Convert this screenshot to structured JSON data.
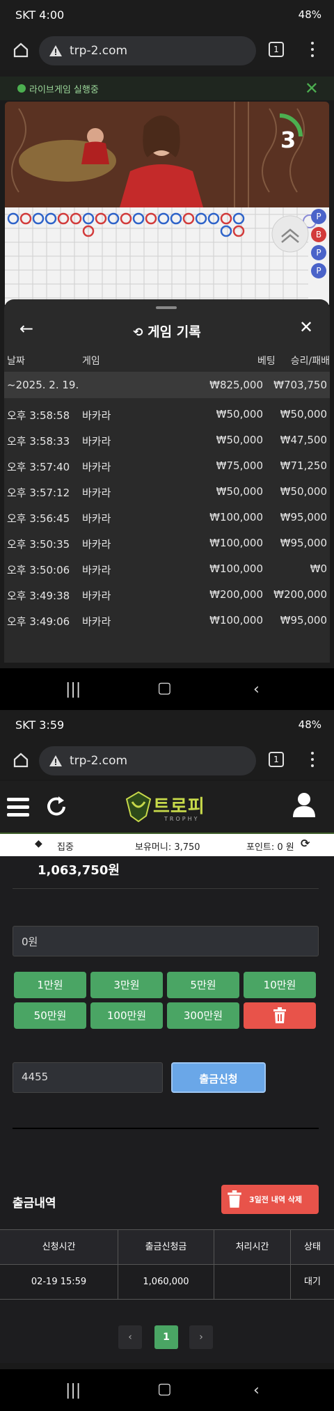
{
  "screen1": {
    "status": {
      "time": "SKT 4:00",
      "right": "48%"
    },
    "browser": {
      "url": "trp-2.com",
      "tabs": "1"
    },
    "live": {
      "label": "라이브게임 실행중"
    },
    "video": {
      "countdown": "3"
    },
    "bead_side": [
      "P",
      "B",
      "P",
      "P"
    ],
    "history": {
      "title": "게임 기록",
      "headers": {
        "date": "날짜",
        "game": "게임",
        "bet": "베팅",
        "result": "승리/패배"
      },
      "summary": {
        "date": "~2025. 2. 19.",
        "bet": "₩825,000",
        "result": "₩703,750"
      },
      "rows": [
        {
          "time": "오후 3:58:58",
          "game": "바카라",
          "bet": "₩50,000",
          "result": "₩50,000"
        },
        {
          "time": "오후 3:58:33",
          "game": "바카라",
          "bet": "₩50,000",
          "result": "₩47,500"
        },
        {
          "time": "오후 3:57:40",
          "game": "바카라",
          "bet": "₩75,000",
          "result": "₩71,250"
        },
        {
          "time": "오후 3:57:12",
          "game": "바카라",
          "bet": "₩50,000",
          "result": "₩50,000"
        },
        {
          "time": "오후 3:56:45",
          "game": "바카라",
          "bet": "₩100,000",
          "result": "₩95,000"
        },
        {
          "time": "오후 3:50:35",
          "game": "바카라",
          "bet": "₩100,000",
          "result": "₩95,000"
        },
        {
          "time": "오후 3:50:06",
          "game": "바카라",
          "bet": "₩100,000",
          "result": "₩0"
        },
        {
          "time": "오후 3:49:38",
          "game": "바카라",
          "bet": "₩200,000",
          "result": "₩200,000"
        },
        {
          "time": "오후 3:49:06",
          "game": "바카라",
          "bet": "₩100,000",
          "result": "₩95,000"
        }
      ]
    }
  },
  "screen2": {
    "status": {
      "time": "SKT 3:59",
      "right": "48%"
    },
    "browser": {
      "url": "trp-2.com",
      "tabs": "1"
    },
    "logo": {
      "main": "트로피",
      "sub": "TROPHY"
    },
    "info": {
      "focus": "집중",
      "money": "보유머니: 3,750",
      "points": "포인트: 0 원"
    },
    "balance": "1,063,750원",
    "amount_input": "0원",
    "quick_amounts": [
      "1만원",
      "3만원",
      "5만원",
      "10만원",
      "50만원",
      "100만원",
      "300만원"
    ],
    "pin_input": "4455",
    "withdraw_button": "출금신청",
    "history_title": "출금내역",
    "delete_button": "3일전 내역 삭제",
    "table": {
      "headers": [
        "신청시간",
        "출금신청금",
        "처리시간",
        "상태"
      ],
      "rows": [
        [
          "02-19 15:59",
          "1,060,000",
          "",
          "대기"
        ]
      ]
    },
    "pager": {
      "prev": "‹",
      "current": "1",
      "next": "›"
    }
  }
}
